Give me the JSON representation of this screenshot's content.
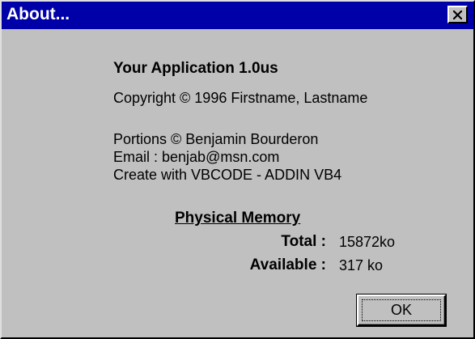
{
  "window": {
    "title": "About...",
    "close_glyph": "✕"
  },
  "app": {
    "name": "Your Application 1.0us",
    "copyright": "Copyright © 1996 Firstname, Lastname"
  },
  "credits": {
    "portions": "Portions © Benjamin Bourderon",
    "email": "Email : benjab@msn.com",
    "created": "Create with VBCODE - ADDIN VB4"
  },
  "memory": {
    "heading": "Physical Memory",
    "total_label": "Total :",
    "total_value": "15872ko",
    "available_label": "Available :",
    "available_value": "317 ko"
  },
  "buttons": {
    "ok_label": "OK"
  },
  "colors": {
    "titlebar": "#0000a8",
    "face": "#c0c0c0"
  },
  "icons": {
    "close": "close-icon"
  }
}
